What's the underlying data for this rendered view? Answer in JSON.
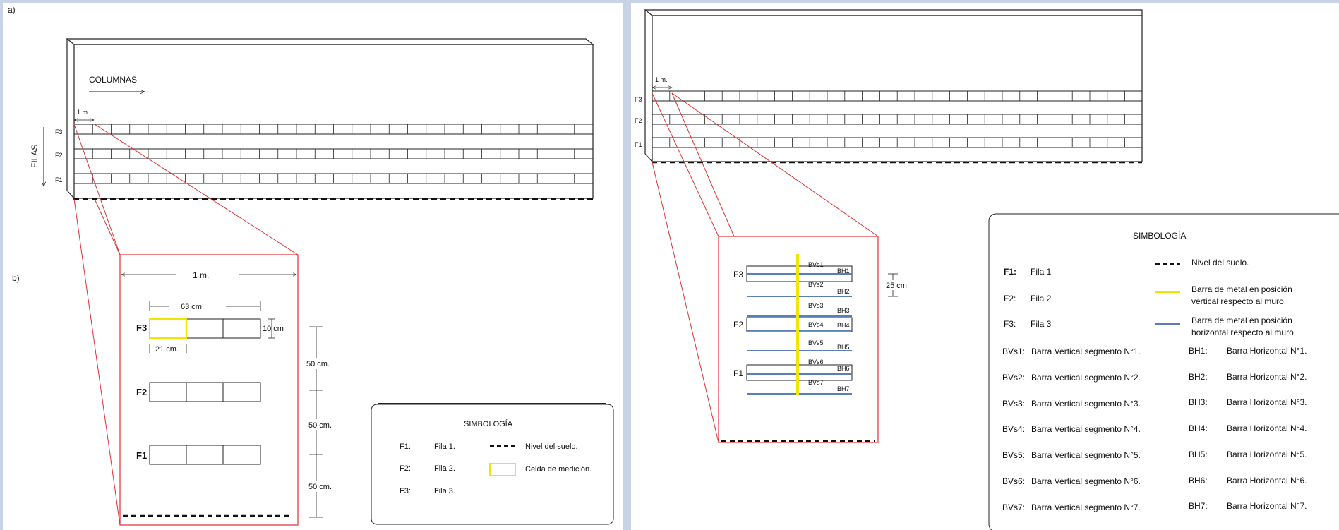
{
  "panel_a_label": "a)",
  "panel_b_label": "b)",
  "columns_label": "COLUMNAS",
  "rows_label": "FILAS",
  "row_labels": [
    "F3",
    "F2",
    "F1"
  ],
  "one_meter_short": "1 m.",
  "detail": {
    "width_label": "1 m.",
    "cells_width_label": "63 cm.",
    "cell_height_label": "10 cm",
    "cell_width_label": "21 cm.",
    "spacing_labels": [
      "50 cm.",
      "50 cm.",
      "50 cm."
    ]
  },
  "legend_left": {
    "title": "SIMBOLOGÍA",
    "rows": [
      {
        "key": "F1:",
        "value": "Fila 1."
      },
      {
        "key": "F2:",
        "value": "Fila 2."
      },
      {
        "key": "F3:",
        "value": "Fila 3."
      }
    ],
    "symbols": [
      "Nivel del suelo.",
      "Celda de medición."
    ]
  },
  "right_detail": {
    "vertical_bars": [
      "BVs1",
      "BVs2",
      "BVs3",
      "BVs4",
      "BVs5",
      "BVs6",
      "BVs7"
    ],
    "horizontal_bars": [
      "BH1",
      "BH2",
      "BH3",
      "BH4",
      "BH5",
      "BH6",
      "BH7"
    ],
    "gap_label": "25 cm."
  },
  "legend_right": {
    "title": "SIMBOLOGÍA",
    "rows": [
      {
        "key": "F1:",
        "value": "Fila 1"
      },
      {
        "key": "F2:",
        "value": "Fila 2"
      },
      {
        "key": "F3:",
        "value": "Fila 3"
      }
    ],
    "symbols": [
      "Nivel del suelo.",
      "Barra de metal en posición",
      "vertical respecto al muro.",
      "Barra de metal en posición",
      "horizontal respecto al muro."
    ],
    "bv_defs": [
      {
        "key": "BVs1:",
        "value": "Barra Vertical segmento N°1."
      },
      {
        "key": "BVs2:",
        "value": "Barra Vertical segmento N°2."
      },
      {
        "key": "BVs3:",
        "value": "Barra Vertical segmento N°3."
      },
      {
        "key": "BVs4:",
        "value": "Barra Vertical segmento N°4."
      },
      {
        "key": "BVs5:",
        "value": "Barra Vertical segmento N°5."
      },
      {
        "key": "BVs6:",
        "value": "Barra Vertical segmento N°6."
      },
      {
        "key": "BVs7:",
        "value": "Barra Vertical segmento N°7."
      }
    ],
    "bh_defs": [
      {
        "key": "BH1:",
        "value": "Barra Horizontal N°1."
      },
      {
        "key": "BH2:",
        "value": "Barra Horizontal N°2."
      },
      {
        "key": "BH3:",
        "value": "Barra Horizontal N°3."
      },
      {
        "key": "BH4:",
        "value": "Barra Horizontal N°4."
      },
      {
        "key": "BH5:",
        "value": "Barra Horizontal N°5."
      },
      {
        "key": "BH6:",
        "value": "Barra Horizontal N°6."
      },
      {
        "key": "BH7:",
        "value": "Barra Horizontal N°7."
      }
    ]
  },
  "colors": {
    "red": "#e23030",
    "yellow": "#f2e600",
    "blue": "#5b7fb5"
  }
}
